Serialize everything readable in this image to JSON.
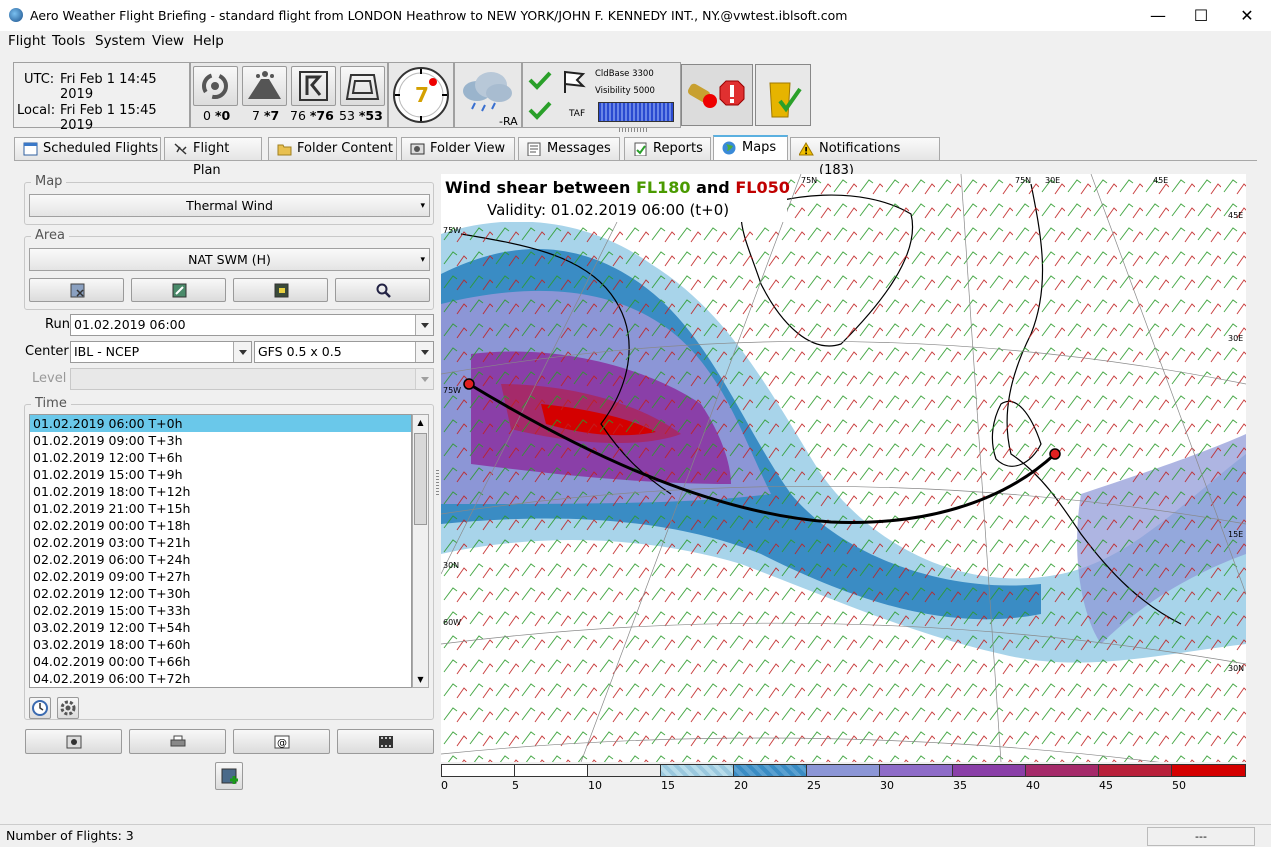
{
  "window": {
    "title": "Aero Weather Flight Briefing - standard flight from LONDON Heathrow to NEW YORK/JOHN F. KENNEDY INT., NY.@vwtest.iblsoft.com",
    "minimize": "—",
    "maximize": "☐",
    "close": "✕"
  },
  "menu": [
    "Flight",
    "Tools",
    "System",
    "View",
    "Help"
  ],
  "time": {
    "utc_label": "UTC:",
    "utc_value": "Fri Feb 1 14:45 2019",
    "local_label": "Local:",
    "local_value": "Fri Feb 1 15:45 2019"
  },
  "hazards": [
    {
      "icon": "cyclone-icon",
      "count": "0",
      "count_bold": "*0"
    },
    {
      "icon": "volcano-icon",
      "count": "7",
      "count_bold": "*7"
    },
    {
      "icon": "sigmet-icon",
      "count": "76",
      "count_bold": "*76"
    },
    {
      "icon": "airmet-icon",
      "count": "53",
      "count_bold": "*53"
    }
  ],
  "clock": {
    "value": "7"
  },
  "weather": {
    "code": "-RA"
  },
  "taf": {
    "label": "TAF",
    "cldbase": "CldBase 3300",
    "visibility": "Visibility 5000"
  },
  "tabs": [
    {
      "label": "Scheduled Flights",
      "icon": "calendar-icon"
    },
    {
      "label": "Flight Plan",
      "icon": "plane-icon"
    },
    {
      "label": "Folder Content",
      "icon": "folder-icon"
    },
    {
      "label": "Folder View",
      "icon": "folder-view-icon"
    },
    {
      "label": "Messages",
      "icon": "messages-icon"
    },
    {
      "label": "Reports",
      "icon": "reports-icon"
    },
    {
      "label": "Maps",
      "icon": "globe-icon"
    },
    {
      "label": "Notifications (183)",
      "icon": "warning-icon"
    }
  ],
  "left": {
    "map_label": "Map",
    "map_value": "Thermal Wind",
    "area_label": "Area",
    "area_value": "NAT SWM (H)",
    "run_label": "Run",
    "run_value": "01.02.2019 06:00",
    "center_label": "Center",
    "center_value": "IBL - NCEP",
    "model_value": "GFS 0.5 x 0.5",
    "level_label": "Level",
    "time_label": "Time",
    "times": [
      "01.02.2019 06:00 T+0h",
      "01.02.2019 09:00 T+3h",
      "01.02.2019 12:00 T+6h",
      "01.02.2019 15:00 T+9h",
      "01.02.2019 18:00 T+12h",
      "01.02.2019 21:00 T+15h",
      "02.02.2019 00:00 T+18h",
      "02.02.2019 03:00 T+21h",
      "02.02.2019 06:00 T+24h",
      "02.02.2019 09:00 T+27h",
      "02.02.2019 12:00 T+30h",
      "02.02.2019 15:00 T+33h",
      "03.02.2019 12:00 T+54h",
      "03.02.2019 18:00 T+60h",
      "04.02.2019 00:00 T+66h",
      "04.02.2019 06:00 T+72h"
    ]
  },
  "map": {
    "title_prefix": "Wind shear between",
    "fl_high": "FL180",
    "title_and": "and",
    "fl_low": "FL050",
    "validity": "Validity: 01.02.2019 06:00 (t+0)",
    "colors": {
      "high": "#4a9a00",
      "low": "#c00000"
    },
    "grid_labels": [
      "75N",
      "75N",
      "30E",
      "45E",
      "45E",
      "30E",
      "75W",
      "15E",
      "30N",
      "60W",
      "30N",
      "75W"
    ],
    "legend_values": [
      "0",
      "5",
      "10",
      "15",
      "20",
      "25",
      "30",
      "35",
      "40",
      "45",
      "50"
    ],
    "legend_colors": [
      "#ffffff",
      "#ffffff",
      "#eeeeee",
      "#9ac8de",
      "#3a8cc4",
      "#8c96d6",
      "#8e6cc8",
      "#8a3fa8",
      "#a52a6a",
      "#b8203a",
      "#d40000"
    ]
  },
  "status": {
    "flights": "Number of Flights: 3",
    "right": "---"
  }
}
